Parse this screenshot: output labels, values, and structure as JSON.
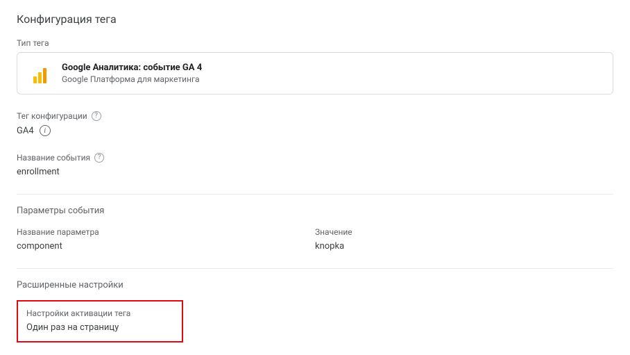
{
  "header": {
    "title": "Конфигурация тега"
  },
  "tag_type": {
    "label": "Тип тега",
    "title": "Google Аналитика: событие GA 4",
    "subtitle": "Google Платформа для маркетинга"
  },
  "config_tag": {
    "label": "Тег конфигурации",
    "value": "GA4"
  },
  "event_name": {
    "label": "Название события",
    "value": "enrollment"
  },
  "event_params": {
    "section_label": "Параметры события",
    "name_header": "Название параметра",
    "value_header": "Значение",
    "rows": [
      {
        "name": "component",
        "value": "knopka"
      }
    ]
  },
  "advanced": {
    "section_label": "Расширенные настройки",
    "activation": {
      "label": "Настройки активации тега",
      "value": "Один раз на страницу"
    }
  }
}
